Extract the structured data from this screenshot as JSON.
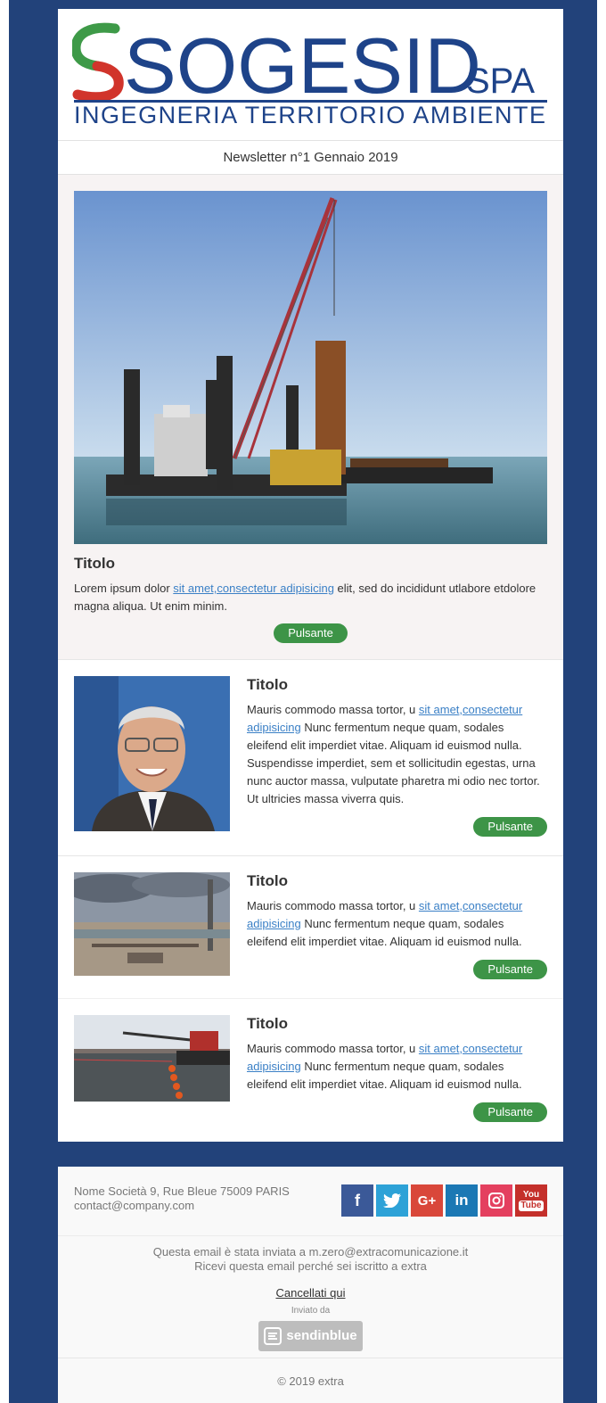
{
  "header": {
    "logo": {
      "brand": "SOGESID",
      "suffix": "SPA",
      "tagline": "INGEGNERIA TERRITORIO AMBIENTE"
    },
    "issue_label": "Newsletter n°1 Gennaio 2019"
  },
  "hero": {
    "title": "Titolo",
    "text_before": "Lorem ipsum dolor ",
    "link": "sit amet,consectetur adipisicing",
    "text_after": " elit, sed do incididunt utlabore etdolore magna aliqua. Ut enim minim.",
    "button": "Pulsante"
  },
  "articles": [
    {
      "title": "Titolo",
      "text_before": "Mauris commodo massa tortor, u ",
      "link": "sit amet,consectetur adipisicing",
      "text_after": " Nunc fermentum neque quam, sodales eleifend elit imperdiet vitae. Aliquam id euismod nulla. Suspendisse imperdiet, sem et sollicitudin egestas, urna nunc auctor massa, vulputate pharetra mi odio nec tortor. Ut ultricies massa viverra quis.",
      "button": "Pulsante"
    },
    {
      "title": "Titolo",
      "text_before": "Mauris commodo massa tortor, u ",
      "link": "sit amet,consectetur adipisicing",
      "text_after": " Nunc fermentum neque quam, sodales eleifend elit imperdiet vitae. Aliquam id euismod nulla.",
      "button": "Pulsante"
    },
    {
      "title": "Titolo",
      "text_before": "Mauris commodo massa tortor, u ",
      "link": "sit amet,consectetur adipisicing",
      "text_after": " Nunc fermentum neque quam, sodales eleifend elit imperdiet vitae. Aliquam id euismod nulla.",
      "button": "Pulsante"
    }
  ],
  "footer": {
    "address": "Nome Società 9, Rue Bleue 75009 PARIS",
    "email": "contact@company.com",
    "social": [
      {
        "icon": "facebook-icon",
        "glyph": "f",
        "color": "#3b5998"
      },
      {
        "icon": "twitter-icon",
        "glyph": "t",
        "color": "#2da2d7"
      },
      {
        "icon": "google-plus-icon",
        "glyph": "G+",
        "color": "#d9473a"
      },
      {
        "icon": "linkedin-icon",
        "glyph": "in",
        "color": "#1b78b4"
      },
      {
        "icon": "instagram-icon",
        "glyph": "◎",
        "color": "#e4405f"
      },
      {
        "icon": "youtube-icon",
        "glyph": "You Tube",
        "color": "#c4302b"
      }
    ],
    "sent_to": "Questa email è stata inviata a m.zero@extracomunicazione.it",
    "reason": "Ricevi questa email perché sei iscritto a extra",
    "unsubscribe": "Cancellati qui",
    "sent_by": "Inviato da",
    "sender_brand": "sendinblue",
    "copyright": "© 2019 extra"
  },
  "colors": {
    "background": "#22427a",
    "brand_blue": "#1e4389",
    "button_green": "#3d9447",
    "link_blue": "#3b80c6"
  }
}
